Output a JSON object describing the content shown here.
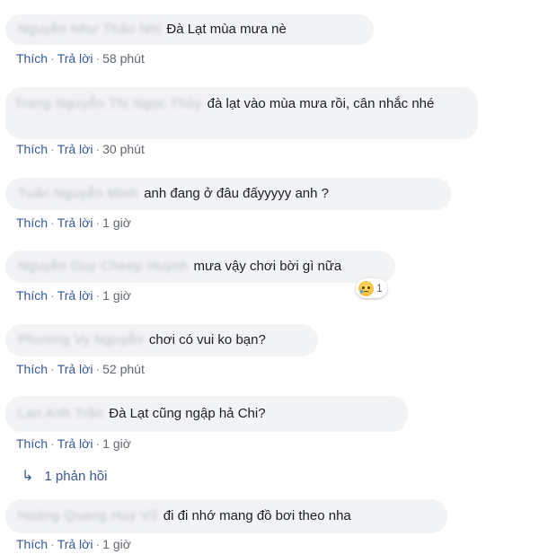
{
  "actions": {
    "like": "Thích",
    "reply": "Trả lời",
    "sep": "·"
  },
  "comments": [
    {
      "name": "Nguyễn Như Thảo Nhi",
      "text": "Đà Lạt mùa mưa nè",
      "time": "58 phút"
    },
    {
      "name": "Trang Nguyễn Thị Ngọc Thủy",
      "text": "đà lạt vào mùa mưa rồi, cân nhắc nhé",
      "time": "30 phút"
    },
    {
      "name": "Tuấn Nguyễn Minh",
      "text": "anh đang ở đâu đấyyyyy anh ?",
      "time": "1 giờ"
    },
    {
      "name": "Nguyễn Duy Cheep Huỳnh",
      "text": "mưa vậy chơi bời gì nữa",
      "time": "1 giờ",
      "reaction": {
        "icon": "sad-reaction-icon",
        "count": "1"
      }
    },
    {
      "name": "Phương Vy Nguyễn",
      "text": "chơi có vui ko bạn?",
      "time": "52 phút"
    },
    {
      "name": "Lan Anh Trần",
      "text": "Đà Lạt cũng ngập hả Chi?",
      "time": "1 giờ",
      "replies": "1 phản hồi"
    },
    {
      "name": "Hoàng Quang Huy Vũ",
      "text": "đi đi nhớ mang đồ bơi theo nha",
      "time": "1 giờ"
    }
  ]
}
